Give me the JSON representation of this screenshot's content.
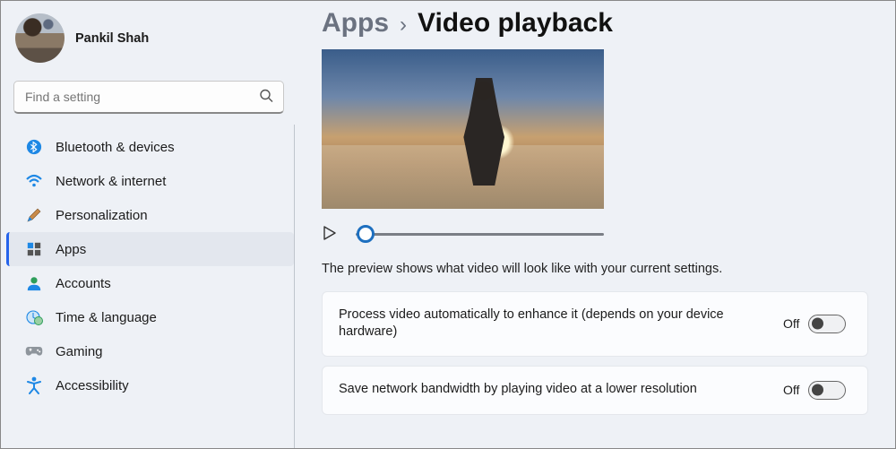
{
  "profile": {
    "name": "Pankil Shah"
  },
  "search": {
    "placeholder": "Find a setting"
  },
  "sidebar": {
    "items": [
      {
        "label": "Bluetooth & devices",
        "icon": "bluetooth-icon",
        "selected": false
      },
      {
        "label": "Network & internet",
        "icon": "wifi-icon",
        "selected": false
      },
      {
        "label": "Personalization",
        "icon": "brush-icon",
        "selected": false
      },
      {
        "label": "Apps",
        "icon": "apps-icon",
        "selected": true
      },
      {
        "label": "Accounts",
        "icon": "person-icon",
        "selected": false
      },
      {
        "label": "Time & language",
        "icon": "clock-globe-icon",
        "selected": false
      },
      {
        "label": "Gaming",
        "icon": "gamepad-icon",
        "selected": false
      },
      {
        "label": "Accessibility",
        "icon": "accessibility-icon",
        "selected": false
      }
    ]
  },
  "breadcrumb": {
    "parent": "Apps",
    "sep": "›",
    "title": "Video playback"
  },
  "preview": {
    "caption": "The preview shows what video will look like with your current settings.",
    "progress_pct": 4
  },
  "settings": [
    {
      "label": "Process video automatically to enhance it (depends on your device hardware)",
      "state": "Off",
      "on": false
    },
    {
      "label": "Save network bandwidth by playing video at a lower resolution",
      "state": "Off",
      "on": false
    }
  ]
}
